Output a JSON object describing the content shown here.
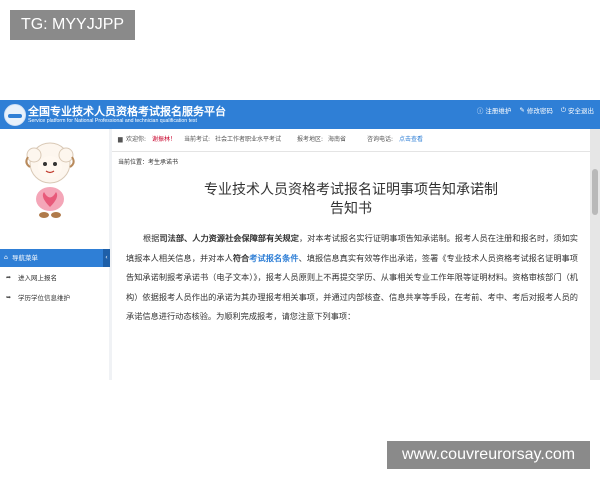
{
  "watermarks": {
    "top": "TG: MYYJJPP",
    "bottom": "www.couvreurorsay.com"
  },
  "header": {
    "title": "全国专业技术人员资格考试报名服务平台",
    "subtitle": "Service platform for National Professional and technician qualification test",
    "links": [
      {
        "icon": "info-icon",
        "label": "注册维护"
      },
      {
        "icon": "edit-icon",
        "label": "修改密码"
      },
      {
        "icon": "exit-icon",
        "label": "安全退出"
      }
    ],
    "bg_color": "#2f7fd6"
  },
  "infobar": {
    "welcome_label": "欢迎你:",
    "user_name": "谢振林！",
    "exam_label": "当前考试:",
    "exam_name": "社会工作者职业水平考试",
    "region_label": "报考地区:",
    "region_name": "海南省",
    "notice_label": "咨询电话:",
    "notice_link": "点击查看"
  },
  "sidebar": {
    "nav_header": "导航菜单",
    "collapse_icon": "chevron-left-icon",
    "items": [
      {
        "icon": "share-icon",
        "label": "进入网上报名"
      },
      {
        "icon": "forward-icon",
        "label": "学历学位信息维护"
      }
    ]
  },
  "breadcrumb": {
    "prefix": "当前位置：",
    "current": "考生承诺书"
  },
  "document": {
    "title_line1": "专业技术人员资格考试报名证明事项告知承诺制",
    "title_line2": "告知书",
    "p1_a": "根据",
    "p1_b": "司法部、人力资源社会保障部有关规定",
    "p1_c": "，对本考试报名实行证明事项告知承诺制。报考人员在注册和报名时，须如实填报本人相关信息，并对本人",
    "p1_d": "符合",
    "p1_e": "考试报名条件",
    "p1_f": "、填报信息真实有效等作出承诺，签署《专业技术人员资格考试报名证明事项告知承诺制报考承诺书（电子文本）》，报考人员原则上不再提交学历、从事相关专业工作年限等证明材料。资格审核部门（机构）依据报考人员作出的承诺为其办理报考相关事项，并通过内部核查、信息共享等手段，在考前、考中、考后对报考人员的承诺信息进行动态核验。为顺利完成报考，请您注意下列事项："
  }
}
